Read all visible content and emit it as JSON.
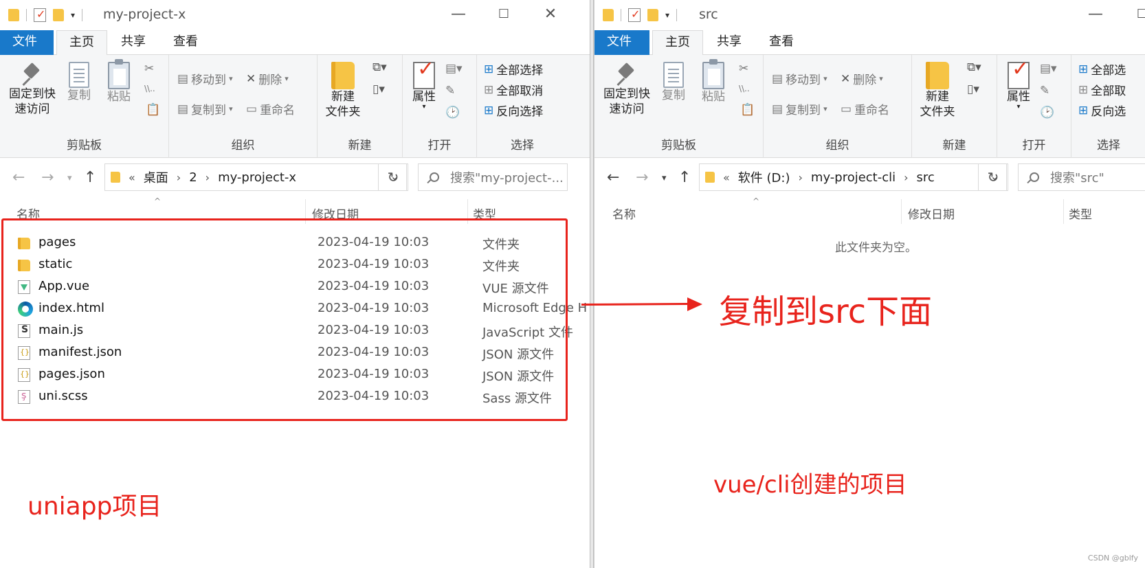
{
  "left": {
    "title": "my-project-x",
    "tabs": [
      "文件",
      "主页",
      "共享",
      "查看"
    ],
    "ribbon": {
      "clipboard": {
        "pin": "固定到快\n速访问",
        "copy": "复制",
        "paste": "粘贴",
        "label": "剪贴板"
      },
      "organize": {
        "move_to": "移动到",
        "copy_to": "复制到",
        "delete": "删除",
        "rename": "重命名",
        "label": "组织"
      },
      "new": {
        "new_folder": "新建\n文件夹",
        "label": "新建"
      },
      "open": {
        "properties": "属性",
        "label": "打开"
      },
      "select": {
        "select_all": "全部选择",
        "select_none": "全部取消",
        "invert": "反向选择",
        "label": "选择"
      }
    },
    "breadcrumb": [
      "桌面",
      "2",
      "my-project-x"
    ],
    "breadcrumb_prefix": "«",
    "search_placeholder": "搜索\"my-project-...",
    "columns": {
      "name": "名称",
      "date": "修改日期",
      "type": "类型"
    },
    "files": [
      {
        "name": "pages",
        "date": "2023-04-19 10:03",
        "type": "文件夹",
        "icon": "folder-icon"
      },
      {
        "name": "static",
        "date": "2023-04-19 10:03",
        "type": "文件夹",
        "icon": "folder-icon"
      },
      {
        "name": "App.vue",
        "date": "2023-04-19 10:03",
        "type": "VUE 源文件",
        "icon": "vue-file-icon"
      },
      {
        "name": "index.html",
        "date": "2023-04-19 10:03",
        "type": "Microsoft Edge H",
        "icon": "edge-html-icon"
      },
      {
        "name": "main.js",
        "date": "2023-04-19 10:03",
        "type": "JavaScript 文件",
        "icon": "js-file-icon"
      },
      {
        "name": "manifest.json",
        "date": "2023-04-19 10:03",
        "type": "JSON 源文件",
        "icon": "json-file-icon"
      },
      {
        "name": "pages.json",
        "date": "2023-04-19 10:03",
        "type": "JSON 源文件",
        "icon": "json-file-icon"
      },
      {
        "name": "uni.scss",
        "date": "2023-04-19 10:03",
        "type": "Sass 源文件",
        "icon": "scss-file-icon"
      }
    ]
  },
  "right": {
    "title": "src",
    "tabs": [
      "文件",
      "主页",
      "共享",
      "查看"
    ],
    "ribbon": {
      "clipboard": {
        "pin": "固定到快\n速访问",
        "copy": "复制",
        "paste": "粘贴",
        "label": "剪贴板"
      },
      "organize": {
        "move_to": "移动到",
        "copy_to": "复制到",
        "delete": "删除",
        "rename": "重命名",
        "label": "组织"
      },
      "new": {
        "new_folder": "新建\n文件夹",
        "label": "新建"
      },
      "open": {
        "properties": "属性",
        "label": "打开"
      },
      "select": {
        "select_all": "全部选",
        "select_none": "全部取",
        "invert": "反向选",
        "label": "选择"
      }
    },
    "breadcrumb": [
      "软件 (D:)",
      "my-project-cli",
      "src"
    ],
    "breadcrumb_prefix": "«",
    "search_placeholder": "搜索\"src\"",
    "columns": {
      "name": "名称",
      "date": "修改日期",
      "type": "类型"
    },
    "empty_message": "此文件夹为空。"
  },
  "annotations": {
    "copy_to_src": "复制到src下面",
    "uniapp_project": "uniapp项目",
    "vue_cli_project": "vue/cli创建的项目",
    "accent_color": "#e8231c"
  },
  "watermark": "CSDN @gblfy"
}
